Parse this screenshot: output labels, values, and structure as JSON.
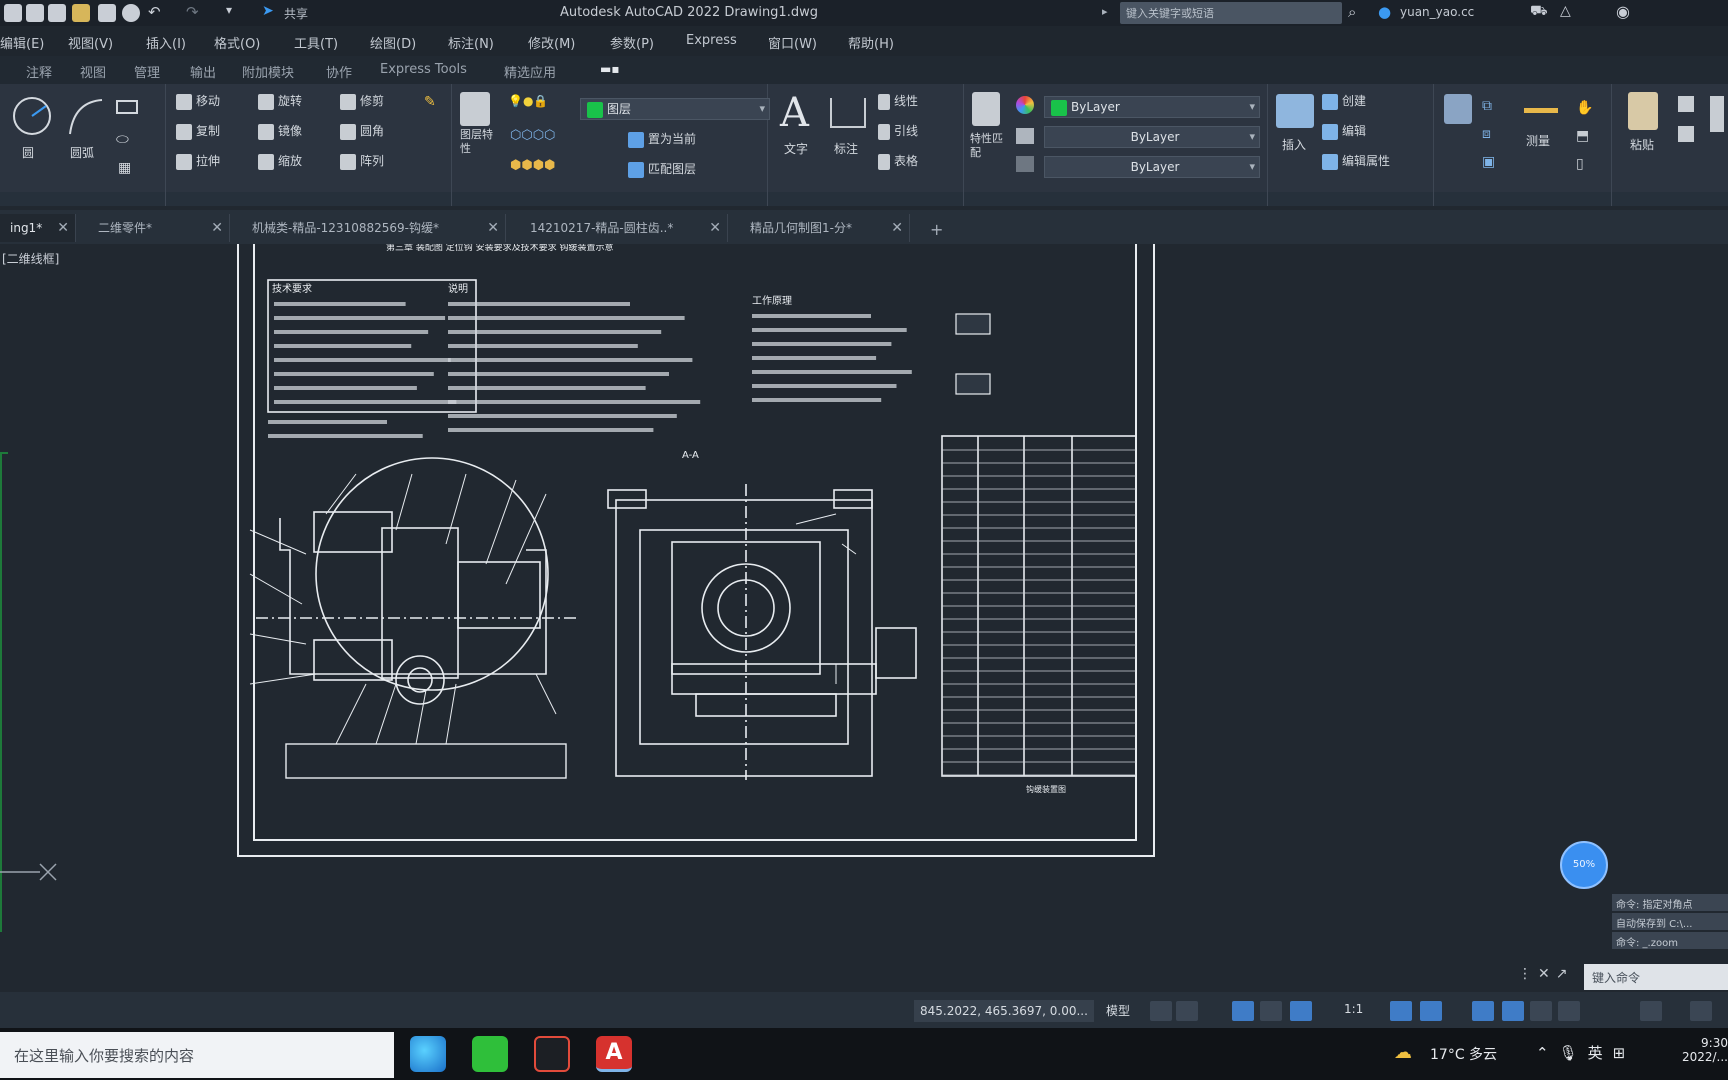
{
  "title_bar": {
    "share_label": "共享",
    "app_title": "Autodesk AutoCAD 2022    Drawing1.dwg",
    "search_placeholder": "键入关键字或短语",
    "user": "yuan_yao.cc"
  },
  "menu": [
    "编辑(E)",
    "视图(V)",
    "插入(I)",
    "格式(O)",
    "工具(T)",
    "绘图(D)",
    "标注(N)",
    "修改(M)",
    "参数(P)",
    "Express",
    "窗口(W)",
    "帮助(H)"
  ],
  "ribbon_tabs": [
    "注释",
    "视图",
    "管理",
    "输出",
    "附加模块",
    "协作",
    "Express Tools",
    "精选应用"
  ],
  "ribbon": {
    "draw": {
      "circle": "圆",
      "arc": "圆弧"
    },
    "modify": [
      "移动",
      "旋转",
      "修剪",
      "复制",
      "镜像",
      "圆角",
      "拉伸",
      "缩放",
      "阵列"
    ],
    "layers": {
      "current": "图层",
      "layer_properties": "图层特性",
      "set_current": "置为当前",
      "match_layer": "匹配图层"
    },
    "annotation": {
      "text": "文字",
      "dimension": "标注",
      "linear": "线性",
      "leader": "引线",
      "table": "表格"
    },
    "properties": {
      "match": "特性匹配",
      "color": "ByLayer",
      "linetype": "ByLayer",
      "lineweight": "ByLayer"
    },
    "block": {
      "insert": "插入",
      "create": "创建",
      "edit": "编辑",
      "edit_attr": "编辑属性"
    },
    "groups": {
      "measure": "测量",
      "paste": "粘贴"
    }
  },
  "doc_tabs": [
    {
      "label": "ing1*",
      "active": true
    },
    {
      "label": "二维零件*",
      "active": false
    },
    {
      "label": "机械类-精品-12310882569-钩缓*",
      "active": false
    },
    {
      "label": "14210217-精品-圆柱齿..*",
      "active": false
    },
    {
      "label": "精品几何制图1-分*",
      "active": false
    }
  ],
  "canvas": {
    "view_label": "[二维线框]",
    "drawing_header": "第三章   装配图   定位钩   安装要求及技术要求   钩缓装置示意",
    "tech_req_title": "技术要求",
    "notes_title": "说明",
    "description_title": "工作原理",
    "section_label": "A-A",
    "title_block_footer": "钩缓装置图"
  },
  "nav_ball_label": "50%",
  "command": {
    "history": [
      "命令: 指定对角点",
      "自动保存到 C:\\...",
      "命令: _.zoom"
    ],
    "input_placeholder": "键入命令"
  },
  "status_bar": {
    "coords": "845.2022, 465.3697, 0.00...",
    "model": "模型",
    "scale": "1:1"
  },
  "taskbar": {
    "search_placeholder": "在这里输入你要搜索的内容",
    "weather": "17°C 多云",
    "time": "9:30",
    "date": "2022/..."
  },
  "colors": {
    "accent": "#3f7cc7",
    "canvas": "#212830",
    "ribbon": "#2c3440",
    "layer_green": "#19c24a"
  }
}
